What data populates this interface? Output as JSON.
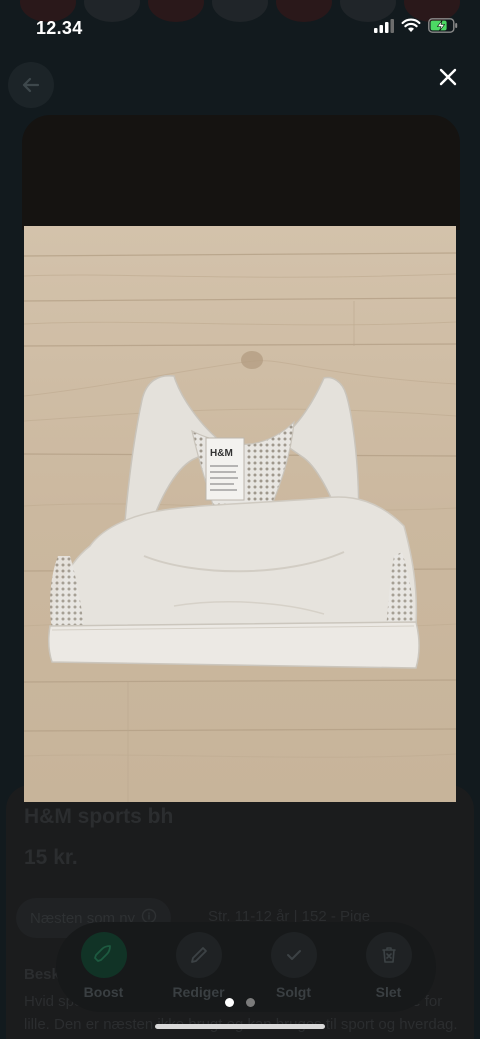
{
  "status_bar": {
    "time": "12.34"
  },
  "listing": {
    "title": "H&M sports bh",
    "price": "15 kr.",
    "condition": "Næsten som ny",
    "size": "Str. 11-12 år | 152 - Pige",
    "description_heading": "Beskrivelse",
    "description": "Hvid sports bh fra H&M. Str 11-12 år, men begynder at blive for lille. Den er næsten ikke brugt og kan bruges til sport og hverdag."
  },
  "actions": [
    {
      "label": "Boost",
      "icon": "rocket-icon"
    },
    {
      "label": "Rediger",
      "icon": "pencil-icon"
    },
    {
      "label": "Solgt",
      "icon": "check-icon"
    },
    {
      "label": "Slet",
      "icon": "trash-icon"
    }
  ],
  "gallery": {
    "page_count": 2,
    "current_page": 1
  },
  "colors": {
    "overlay": "#000000",
    "boost_accent": "#113326",
    "wood_floor": "#cdbba3",
    "garment": "#e6e3dd"
  }
}
